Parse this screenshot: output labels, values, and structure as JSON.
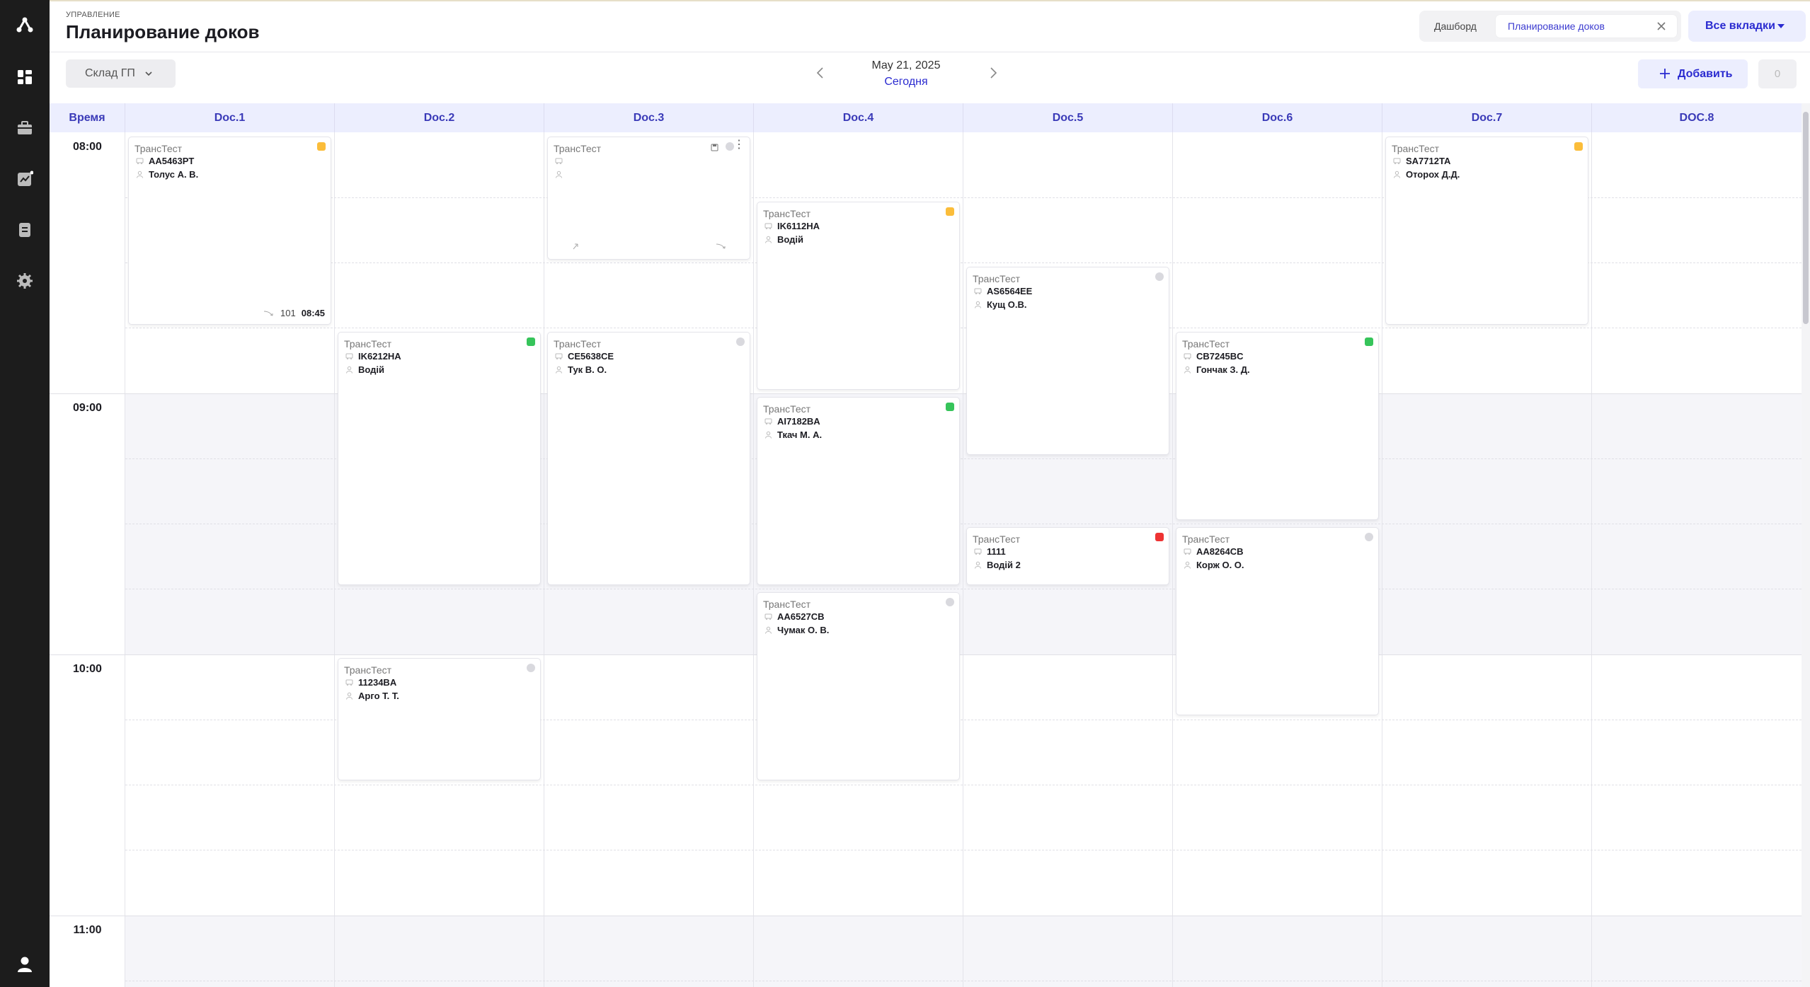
{
  "header": {
    "breadcrumb": "УПРАВЛЕНИЕ",
    "title": "Планирование доков",
    "tab_dashboard": "Дашборд",
    "tab_active": "Планирование доков",
    "all_tabs": "Все вкладки"
  },
  "toolbar": {
    "warehouse": "Склад ГП",
    "date": "May 21, 2025",
    "today": "Сегодня",
    "add_label": "Добавить",
    "count": "0"
  },
  "sidebar": {
    "icons": [
      "logo-icon",
      "dashboard-icon",
      "warehouse-icon",
      "analytics-icon",
      "documents-icon",
      "settings-icon",
      "user-icon"
    ]
  },
  "grid": {
    "time_header": "Время",
    "docks": [
      "Doc.1",
      "Doc.2",
      "Doc.3",
      "Doc.4",
      "Doc.5",
      "Doc.6",
      "Doc.7",
      "DOC.8"
    ],
    "hours": [
      "08:00",
      "09:00",
      "10:00",
      "11:00"
    ]
  },
  "cards": [
    {
      "company": "ТрансТест",
      "plate": "AA5463PT",
      "driver": "Толус А. В.",
      "badge": "orange",
      "foot_num": "101",
      "foot_time": "08:45"
    },
    {
      "company": "ТрансТест",
      "plate": "",
      "driver": "",
      "badge": "grey"
    },
    {
      "company": "ТрансТест",
      "plate": "IK6112HA",
      "driver": "Водій",
      "badge": "orange"
    },
    {
      "company": "ТрансТест",
      "plate": "AS6564EE",
      "driver": "Кущ О.В.",
      "badge": "grey"
    },
    {
      "company": "ТрансТест",
      "plate": "SA7712TA",
      "driver": "Оторох Д.Д.",
      "badge": "orange"
    },
    {
      "company": "ТрансТест",
      "plate": "IK6212HA",
      "driver": "Водій",
      "badge": "green"
    },
    {
      "company": "ТрансТест",
      "plate": "CE5638CE",
      "driver": "Тук В. О.",
      "badge": "grey"
    },
    {
      "company": "ТрансТест",
      "plate": "CB7245BC",
      "driver": "Гончак З. Д.",
      "badge": "green"
    },
    {
      "company": "ТрансТест",
      "plate": "AI7182BA",
      "driver": "Ткач М. А.",
      "badge": "green"
    },
    {
      "company": "ТрансТест",
      "plate": "1111",
      "driver": "Водій 2",
      "badge": "red"
    },
    {
      "company": "ТрансТест",
      "plate": "AA8264CB",
      "driver": "Корж О. О.",
      "badge": "grey"
    },
    {
      "company": "ТрансТест",
      "plate": "AA6527CB",
      "driver": "Чумак О. В.",
      "badge": "grey"
    },
    {
      "company": "ТрансТест",
      "plate": "11234BA",
      "driver": "Арго Т. Т.",
      "badge": "grey"
    }
  ],
  "colors": {
    "accent": "#2a2ad0",
    "sidebar": "#1c1c1c",
    "header_band": "#eceefe"
  }
}
